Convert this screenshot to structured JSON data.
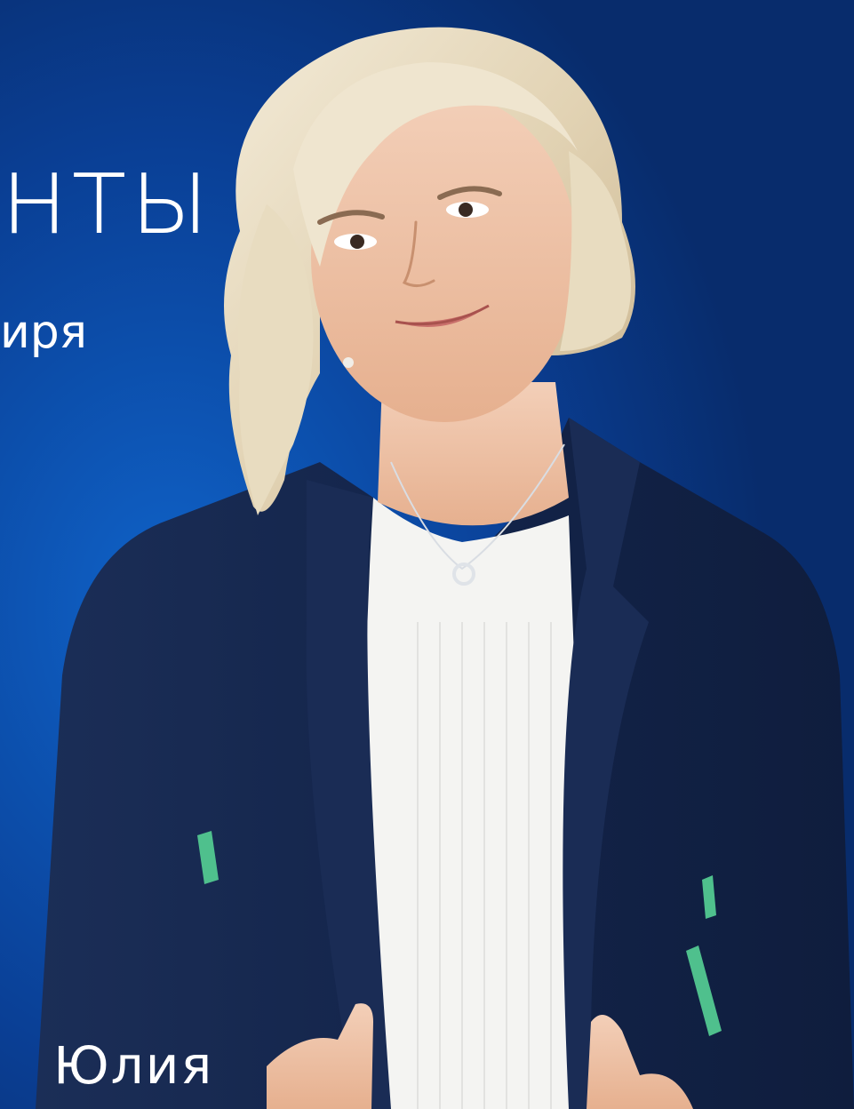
{
  "poster": {
    "headline_fragment": "нты",
    "subline_fragment": "иря",
    "name": "Юлия"
  },
  "colors": {
    "background": "#0a3d8f",
    "jacket": "#13244a",
    "shirt": "#f4f4f2",
    "hair": "#e7dcc3",
    "skin": "#efc2a8",
    "text": "#ffffff"
  }
}
